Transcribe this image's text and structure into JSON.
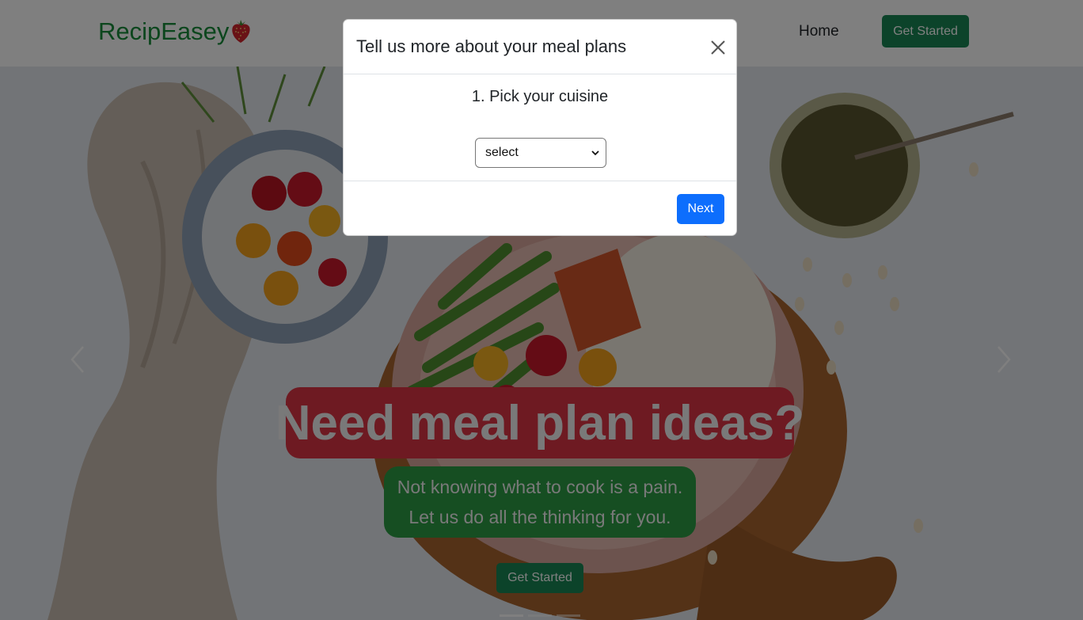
{
  "navbar": {
    "brand": "RecipEasey",
    "brand_icon": "strawberry-icon",
    "home_link": "Home",
    "cta_label": "Get Started",
    "brand_color": "#198d3a",
    "cta_color": "#198754"
  },
  "hero": {
    "headline": "Need meal plan ideas?",
    "subline_1": "Not knowing what to cook is a pain.",
    "subline_2": "Let us do all the thinking for you.",
    "cta_label": "Get Started",
    "headline_bg": "#dc3545",
    "sub_bg": "#2d9d45",
    "slide_count": 3,
    "active_slide": 1,
    "prev_icon": "chevron-left-icon",
    "next_icon": "chevron-right-icon"
  },
  "modal": {
    "title": "Tell us more about your meal plans",
    "close_icon": "close-icon",
    "step_label": "1. Pick your cuisine",
    "select": {
      "selected": "select"
    },
    "next_label": "Next",
    "next_color": "#0d6efd"
  }
}
